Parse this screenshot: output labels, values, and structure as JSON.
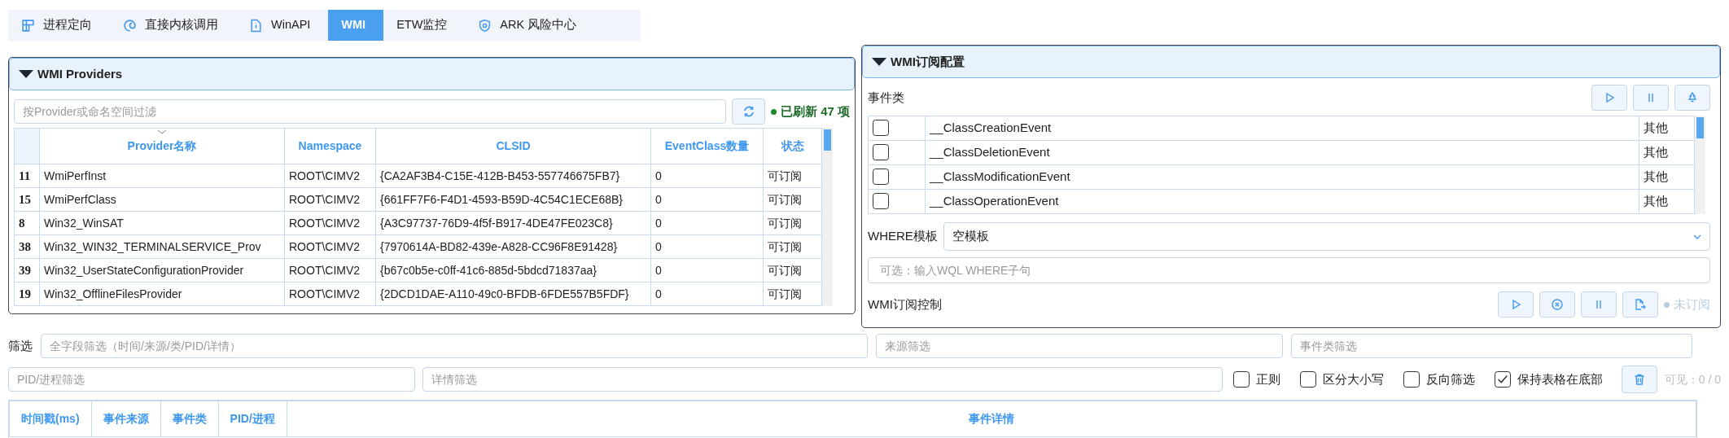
{
  "tabs": [
    {
      "label": "进程定向",
      "kind": "grid",
      "selected": false
    },
    {
      "label": "直接内核调用",
      "kind": "swirl",
      "selected": false
    },
    {
      "label": "WinAPI",
      "kind": "doc",
      "selected": false
    },
    {
      "label": "WMI",
      "kind": "plain",
      "selected": true
    },
    {
      "label": "ETW监控",
      "kind": "plain",
      "selected": false
    },
    {
      "label": "ARK 风险中心",
      "kind": "shield",
      "selected": false
    }
  ],
  "providers_panel": {
    "title": "WMI Providers",
    "expanded": true,
    "filter": {
      "placeholder": "按Provider或命名空间过滤"
    },
    "status": {
      "text": "已刷新 47 项",
      "kind": "success"
    },
    "table": {
      "columns": [
        "Provider名称",
        "Namespace",
        "CLSID",
        "EventClass数量",
        "状态"
      ],
      "rows": [
        {
          "index": "11",
          "cells": [
            "WmiPerfInst",
            "ROOT\\CIMV2",
            "{CA2AF3B4-C15E-412B-B453-557746675FB7}",
            "0",
            "可订阅"
          ]
        },
        {
          "index": "15",
          "cells": [
            "WmiPerfClass",
            "ROOT\\CIMV2",
            "{661FF7F6-F4D1-4593-B59D-4C54C1ECE68B}",
            "0",
            "可订阅"
          ]
        },
        {
          "index": "8",
          "cells": [
            "Win32_WinSAT",
            "ROOT\\CIMV2",
            "{A3C97737-76D9-4f5f-B917-4DE47FE023C8}",
            "0",
            "可订阅"
          ]
        },
        {
          "index": "38",
          "cells": [
            "Win32_WIN32_TERMINALSERVICE_Prov",
            "ROOT\\CIMV2",
            "{7970614A-BD82-439e-A828-CC96F8E91428}",
            "0",
            "可订阅"
          ]
        },
        {
          "index": "39",
          "cells": [
            "Win32_UserStateConfigurationProvider",
            "ROOT\\CIMV2",
            "{b67c0b5e-c0ff-41c6-885d-5bdcd71837aa}",
            "0",
            "可订阅"
          ]
        },
        {
          "index": "19",
          "cells": [
            "Win32_OfflineFilesProvider",
            "ROOT\\CIMV2",
            "{2DCD1DAE-A110-49c0-BFDB-6FDE557B5FDF}",
            "0",
            "可订阅"
          ]
        }
      ]
    }
  },
  "subscription_panel": {
    "title": "WMI订阅配置",
    "expanded": true,
    "event_class_label": "事件类",
    "event_classes": [
      {
        "checked": false,
        "name": "__ClassCreationEvent",
        "category": "其他"
      },
      {
        "checked": false,
        "name": "__ClassDeletionEvent",
        "category": "其他"
      },
      {
        "checked": false,
        "name": "__ClassModificationEvent",
        "category": "其他"
      },
      {
        "checked": false,
        "name": "__ClassOperationEvent",
        "category": "其他"
      }
    ],
    "where_label": "WHERE模板",
    "where_template": "空模板",
    "where_clause": {
      "placeholder": "可选：输入WQL WHERE子句"
    },
    "control_label": "WMI订阅控制",
    "status": {
      "text": "未订阅",
      "kind": "idle"
    }
  },
  "filters": {
    "label": "筛选",
    "all_fields": {
      "placeholder": "全字段筛选（时间/来源/类/PID/详情）"
    },
    "source": {
      "placeholder": "来源筛选"
    },
    "event_class": {
      "placeholder": "事件类筛选"
    },
    "pid": {
      "placeholder": "PID/进程筛选"
    },
    "detail": {
      "placeholder": "详情筛选"
    }
  },
  "options": [
    {
      "label": "正则",
      "checked": false
    },
    {
      "label": "区分大小写",
      "checked": false
    },
    {
      "label": "反向筛选",
      "checked": false
    },
    {
      "label": "保持表格在底部",
      "checked": true
    }
  ],
  "visible_count": "可见：0 / 0",
  "events_table": {
    "columns": [
      "时间戳(ms)",
      "事件来源",
      "事件类",
      "PID/进程",
      "事件详情"
    ]
  }
}
